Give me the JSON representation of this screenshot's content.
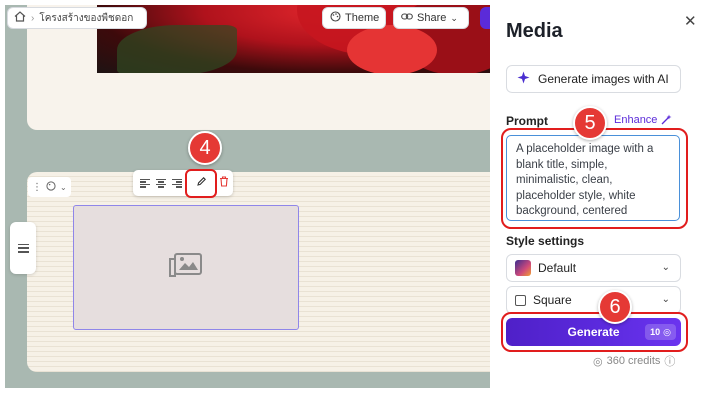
{
  "header": {
    "breadcrumb_label": "โครงสร้างของพืชดอก",
    "theme_label": "Theme",
    "share_label": "Share"
  },
  "panel": {
    "title": "Media",
    "generate_images_label": "Generate images with AI",
    "prompt_label": "Prompt",
    "enhance_label": "Enhance",
    "prompt_text": "A placeholder image with a blank title, simple, minimalistic, clean, placeholder style, white background, centered",
    "style_settings_label": "Style settings",
    "style_value": "Default",
    "aspect_value": "Square",
    "generate_label": "Generate",
    "generate_cost": "10",
    "credits_text": "360 credits"
  },
  "annotations": {
    "step_4": "4",
    "step_5": "5",
    "step_6": "6"
  },
  "colors": {
    "accent": "#5b2bd9",
    "highlight": "#e11d1d",
    "canvas_bg": "#a9b8b1"
  },
  "icons": [
    "home-icon",
    "chevron-right-icon",
    "palette-icon",
    "link-icon",
    "chevron-down-icon",
    "align-left-icon",
    "align-center-icon",
    "align-right-icon",
    "pencil-icon",
    "trash-icon",
    "menu-icon",
    "image-placeholder-icon",
    "close-icon",
    "ai-sparkle-icon",
    "magic-wand-icon",
    "checkbox-icon",
    "credit-icon",
    "info-icon"
  ]
}
